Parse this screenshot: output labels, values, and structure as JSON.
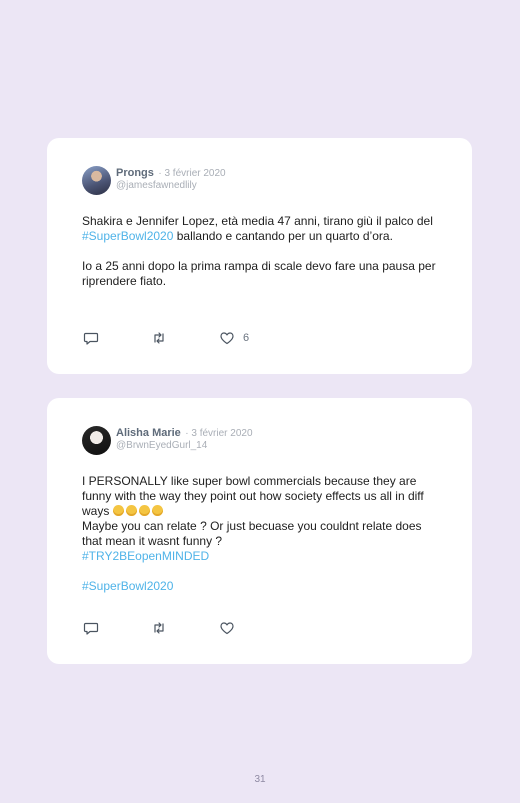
{
  "tweets": [
    {
      "name": "Prongs",
      "date": "· 3 février 2020",
      "handle": "@jamesfawnedlily",
      "line1a": "Shakira e Jennifer Lopez, età media 47 anni, tirano giù il palco del ",
      "tag1": "#SuperBowl2020",
      "line1b": " ballando e cantando per un quarto d’ora.",
      "line2": "Io a 25 anni dopo la prima rampa di scale devo fare una pausa per riprendere fiato.",
      "likes": "6",
      "avatar": "profile-photo"
    },
    {
      "name": "Alisha Marie",
      "date": "· 3 février 2020",
      "handle": "@BrwnEyedGurl_14",
      "line1": "I PERSONALLY like super bowl commercials because they are funny with the way they point out how society effects us all in diff ways",
      "emojis": [
        "thinking-face",
        "zany-face",
        "astonished-face",
        "hugging-face"
      ],
      "line2": "Maybe you can relate ? Or just becuase you couldnt relate does that mean it wasnt funny ?",
      "tag1": "#TRY2BEopenMINDED",
      "tag2": "#SuperBowl2020",
      "avatar": "profile-photo"
    }
  ],
  "page_number": "31",
  "colors": {
    "background": "#ece6f5",
    "card": "#ffffff",
    "hashtag": "#4fb3e8"
  },
  "icons": [
    "reply-icon",
    "retweet-icon",
    "like-icon"
  ]
}
